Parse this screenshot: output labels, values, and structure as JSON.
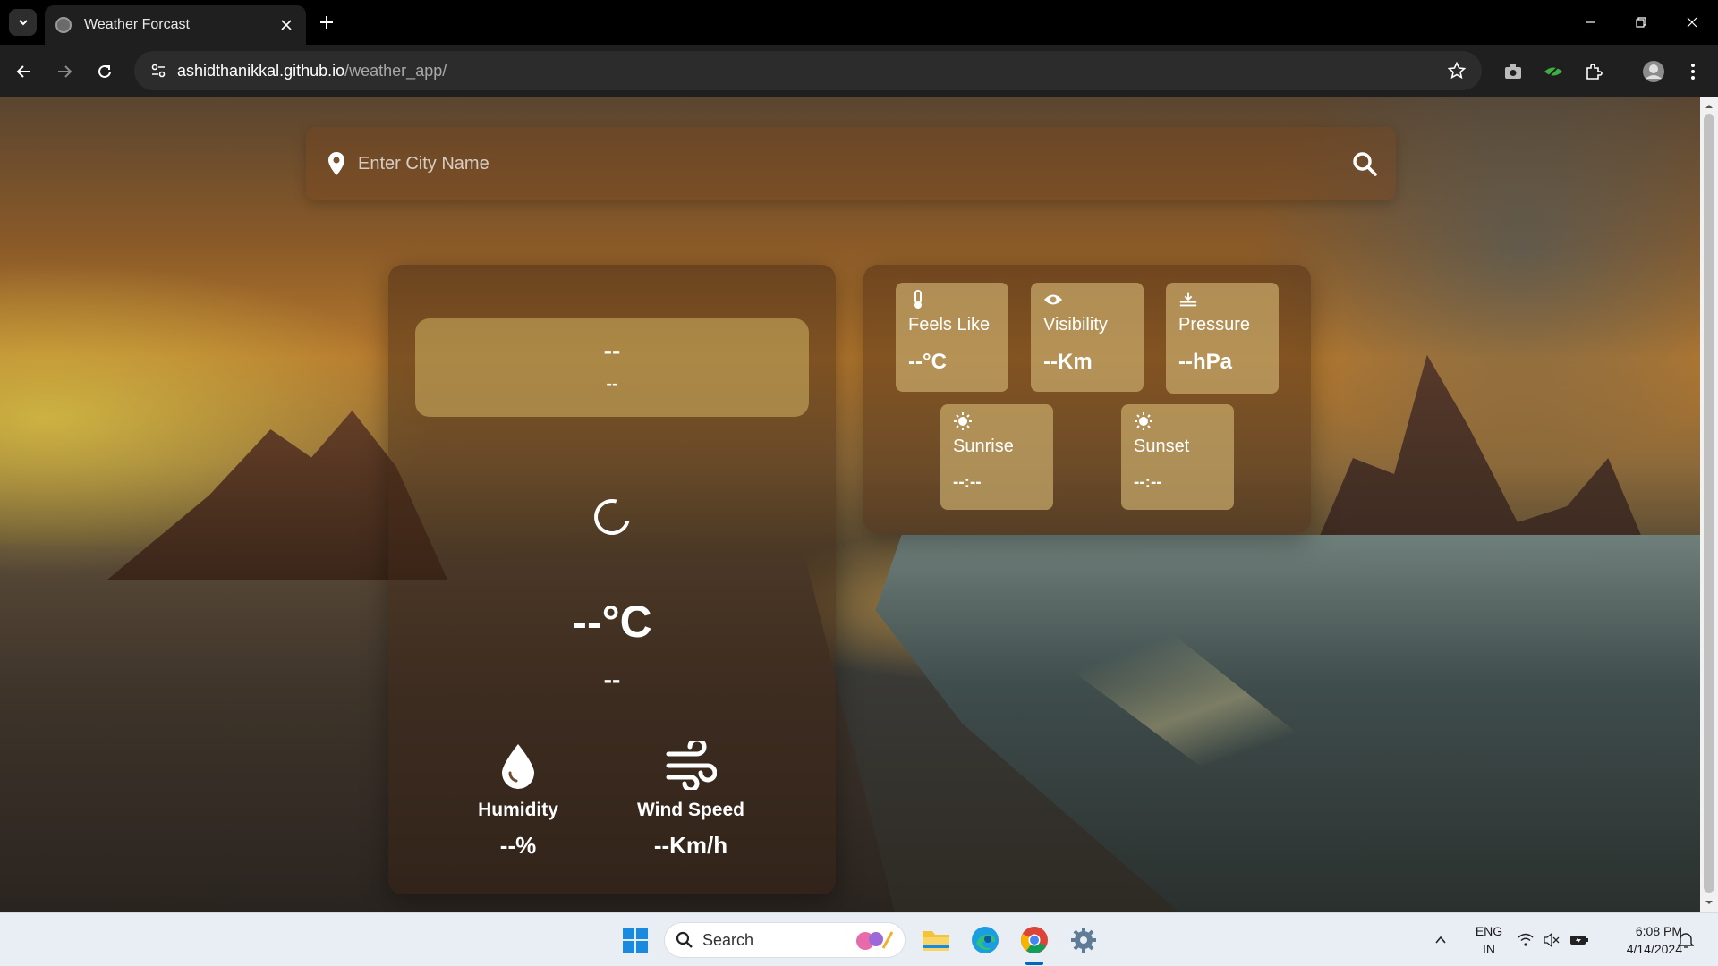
{
  "browser": {
    "tab_title": "Weather Forcast",
    "url_host": "ashidthanikkal.github.io",
    "url_path": "/weather_app/"
  },
  "search": {
    "placeholder": "Enter City Name"
  },
  "weather": {
    "city": "--",
    "date": "--",
    "temperature": "--°C",
    "description": "--",
    "humidity_label": "Humidity",
    "humidity_value": "--%",
    "wind_label": "Wind Speed",
    "wind_value": "--Km/h"
  },
  "details": {
    "feels_like_label": "Feels Like",
    "feels_like_value": "--°C",
    "visibility_label": "Visibility",
    "visibility_value": "--Km",
    "pressure_label": "Pressure",
    "pressure_value": "--hPa",
    "sunrise_label": "Sunrise",
    "sunrise_value": "--:--",
    "sunset_label": "Sunset",
    "sunset_value": "--:--"
  },
  "taskbar": {
    "search_label": "Search",
    "lang_primary": "ENG",
    "lang_secondary": "IN",
    "time": "6:08 PM",
    "date": "4/14/2024"
  },
  "icons": {
    "location": "map-pin-icon",
    "search": "search-icon",
    "humidity": "water-drop-icon",
    "wind": "wind-icon",
    "feels_like": "thermometer-icon",
    "visibility": "eye-icon",
    "pressure": "pressure-icon",
    "sunrise": "sun-icon",
    "sunset": "sun-icon"
  }
}
